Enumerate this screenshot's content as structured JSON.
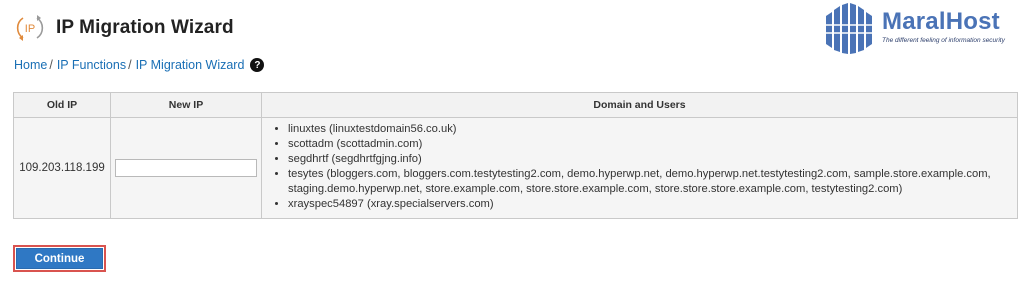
{
  "header": {
    "title": "IP Migration Wizard",
    "icon": "ip-migration-icon",
    "icon_text": "IP"
  },
  "logo": {
    "name": "MaralHost",
    "tagline": "The different feeling of information security",
    "brand_color": "#4a73b6"
  },
  "breadcrumb": {
    "items": [
      "Home",
      "IP Functions",
      "IP Migration Wizard"
    ],
    "separator": "/"
  },
  "table": {
    "headers": {
      "old_ip": "Old IP",
      "new_ip": "New IP",
      "domains": "Domain and Users"
    },
    "row": {
      "old_ip": "109.203.118.199",
      "new_ip_value": "",
      "domains": [
        "linuxtes (linuxtestdomain56.co.uk)",
        "scottadm (scottadmin.com)",
        "segdhrtf (segdhrtfgjng.info)",
        "tesytes (bloggers.com, bloggers.com.testytesting2.com, demo.hyperwp.net, demo.hyperwp.net.testytesting2.com, sample.store.example.com, staging.demo.hyperwp.net, store.example.com, store.store.example.com, store.store.store.example.com, testytesting2.com)",
        "xrayspec54897 (xray.specialservers.com)"
      ]
    }
  },
  "actions": {
    "continue_label": "Continue"
  },
  "colors": {
    "accent": "#2f78c4",
    "highlight": "#d9534f",
    "link": "#1a6fb5"
  }
}
